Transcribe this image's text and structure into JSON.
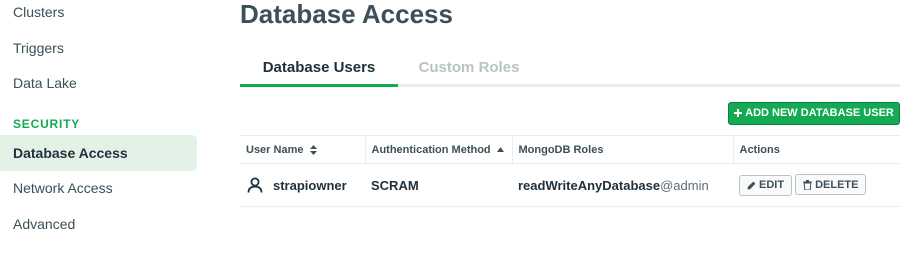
{
  "sidebar": {
    "items_top": [
      {
        "label": "Clusters"
      },
      {
        "label": "Triggers"
      },
      {
        "label": "Data Lake"
      }
    ],
    "section_label": "SECURITY",
    "items_security": [
      {
        "label": "Database Access",
        "active": true
      },
      {
        "label": "Network Access"
      },
      {
        "label": "Advanced"
      }
    ]
  },
  "main": {
    "title": "Database Access",
    "tabs": [
      {
        "label": "Database Users",
        "active": true
      },
      {
        "label": "Custom Roles"
      }
    ],
    "add_button_label": "ADD NEW DATABASE USER",
    "add_button_icon": "plus-icon",
    "table": {
      "columns": [
        "User Name",
        "Authentication Method",
        "MongoDB Roles",
        "Actions"
      ],
      "rows": [
        {
          "user_name": "strapiowner",
          "auth_method": "SCRAM",
          "role": "readWriteAnyDatabase",
          "role_db": "@admin",
          "edit_label": "EDIT",
          "delete_label": "DELETE"
        }
      ]
    }
  },
  "colors": {
    "accent": "#13aa52",
    "active_bg": "#e3f2e7",
    "text": "#3d4f58",
    "muted_tab": "#b8c4c2"
  }
}
